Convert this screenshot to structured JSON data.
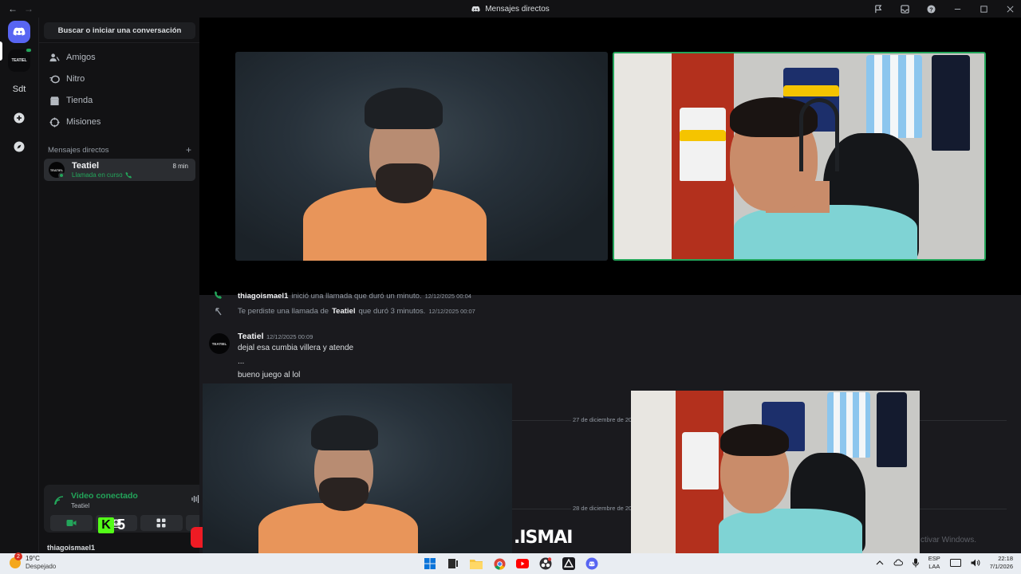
{
  "titlebar": {
    "back": "←",
    "forward": "→",
    "title": "Mensajes directos"
  },
  "rail": {
    "teatiel_logo": "TEATIEL",
    "sdt_label": "Sdt"
  },
  "sidebar": {
    "search_label": "Buscar o iniciar una conversación",
    "nav": [
      {
        "label": "Amigos",
        "icon": "friends-icon"
      },
      {
        "label": "Nitro",
        "icon": "nitro-icon"
      },
      {
        "label": "Tienda",
        "icon": "shop-icon"
      },
      {
        "label": "Misiones",
        "icon": "quests-icon"
      }
    ],
    "dm_header": "Mensajes directos",
    "dm_add": "+",
    "dm": {
      "name": "Teatiel",
      "status": "Llamada en curso",
      "time": "8 min",
      "avatar_text": "TEATIEL"
    }
  },
  "voice": {
    "title": "Video conectado",
    "channel": "Teatiel"
  },
  "overlay_k5": {
    "k": "K",
    "num": "5"
  },
  "user_peek": "thiagoismael1",
  "chat": {
    "line1": {
      "user": "thiagoismael1",
      "text": "inició una llamada que duró un minuto.",
      "ts": "12/12/2025 00:04"
    },
    "line2": {
      "prefix": "Te perdiste una llamada de",
      "user": "Teatiel",
      "suffix": "que duró 3 minutos.",
      "ts": "12/12/2025 00:07"
    },
    "message": {
      "author": "Teatiel",
      "ts": "12/12/2025 00:09",
      "avatar_text": "TEATIEL",
      "lines": [
        "dejal esa cumbia villera y atende",
        "...",
        "bueno juego al lol"
      ]
    },
    "date_dividers": [
      "27 de diciembre de 20",
      "28 de diciembre de 20"
    ],
    "activate": "ctivar Windows."
  },
  "stream_tag": ".ISMAI",
  "taskbar": {
    "weather": {
      "badge": "2",
      "temp": "19°C",
      "cond": "Despejado"
    },
    "lang": {
      "l1": "ESP",
      "l2": "LAA"
    },
    "clock": {
      "time": "22:18",
      "date": "7/1/2026"
    }
  },
  "colors": {
    "accent": "#5865f2",
    "online": "#23a55a",
    "kick_green": "#53fc18"
  }
}
